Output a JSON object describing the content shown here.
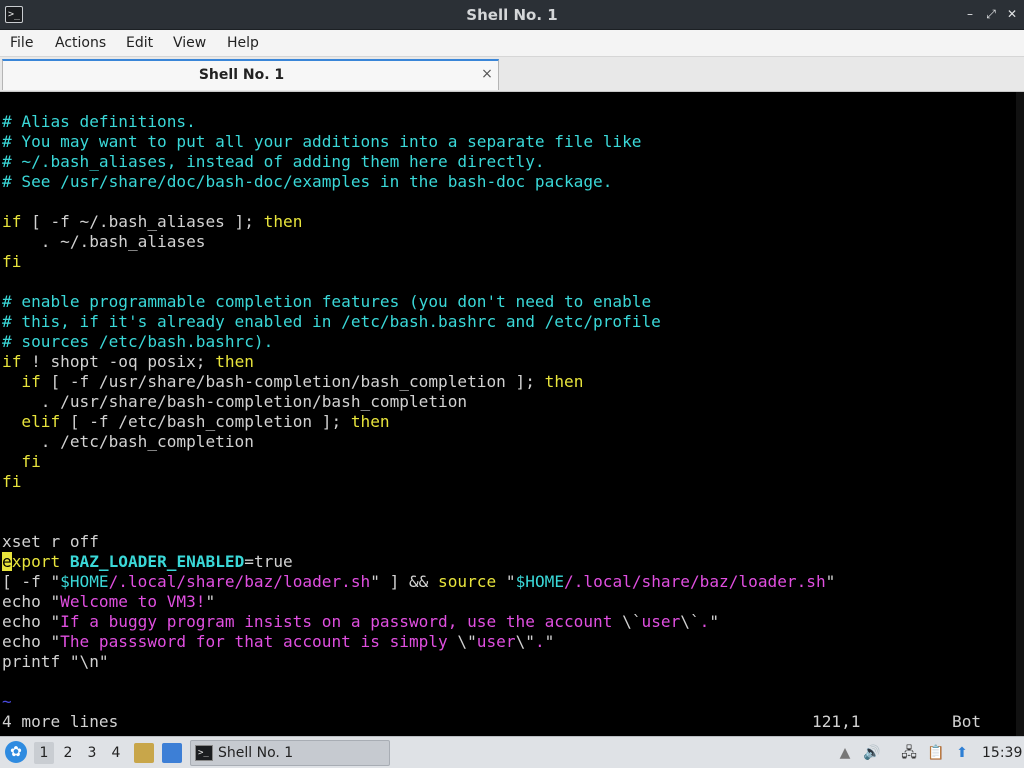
{
  "window": {
    "title": "Shell No. 1",
    "app_icon_glyph": ">_",
    "controls": {
      "minimize": "–",
      "maximize": "⤢",
      "close": "✕"
    }
  },
  "menubar": {
    "items": [
      {
        "label": "File"
      },
      {
        "label": "Actions"
      },
      {
        "label": "Edit"
      },
      {
        "label": "View"
      },
      {
        "label": "Help"
      }
    ]
  },
  "tabs": [
    {
      "label": "Shell No. 1",
      "close": "×",
      "active": true
    }
  ],
  "terminal": {
    "lines": [
      {
        "segments": [
          {
            "text": "# Alias definitions.",
            "cls": "c-cm"
          }
        ]
      },
      {
        "segments": [
          {
            "text": "# You may want to put all your additions into a separate file like",
            "cls": "c-cm"
          }
        ]
      },
      {
        "segments": [
          {
            "text": "# ~/.bash_aliases, instead of adding them here directly.",
            "cls": "c-cm"
          }
        ]
      },
      {
        "segments": [
          {
            "text": "# See /usr/share/doc/bash-doc/examples in the bash-doc package.",
            "cls": "c-cm"
          }
        ]
      },
      {
        "segments": []
      },
      {
        "segments": [
          {
            "text": "if",
            "cls": "c-kw"
          },
          {
            "text": " [ -f ~/.bash_aliases ]; "
          },
          {
            "text": "then",
            "cls": "c-kw"
          }
        ]
      },
      {
        "segments": [
          {
            "text": "    . ~/.bash_aliases"
          }
        ]
      },
      {
        "segments": [
          {
            "text": "fi",
            "cls": "c-kw"
          }
        ]
      },
      {
        "segments": []
      },
      {
        "segments": [
          {
            "text": "# enable programmable completion features (you don't need to enable",
            "cls": "c-cm"
          }
        ]
      },
      {
        "segments": [
          {
            "text": "# this, if it's already enabled in /etc/bash.bashrc and /etc/profile",
            "cls": "c-cm"
          }
        ]
      },
      {
        "segments": [
          {
            "text": "# sources /etc/bash.bashrc).",
            "cls": "c-cm"
          }
        ]
      },
      {
        "segments": [
          {
            "text": "if",
            "cls": "c-kw"
          },
          {
            "text": " ! shopt -oq posix; "
          },
          {
            "text": "then",
            "cls": "c-kw"
          }
        ]
      },
      {
        "segments": [
          {
            "text": "  "
          },
          {
            "text": "if",
            "cls": "c-kw"
          },
          {
            "text": " [ -f /usr/share/bash-completion/bash_completion ]; "
          },
          {
            "text": "then",
            "cls": "c-kw"
          }
        ]
      },
      {
        "segments": [
          {
            "text": "    . /usr/share/bash-completion/bash_completion"
          }
        ]
      },
      {
        "segments": [
          {
            "text": "  "
          },
          {
            "text": "elif",
            "cls": "c-kw"
          },
          {
            "text": " [ -f /etc/bash_completion ]; "
          },
          {
            "text": "then",
            "cls": "c-kw"
          }
        ]
      },
      {
        "segments": [
          {
            "text": "    . /etc/bash_completion"
          }
        ]
      },
      {
        "segments": [
          {
            "text": "  "
          },
          {
            "text": "fi",
            "cls": "c-kw"
          }
        ]
      },
      {
        "segments": [
          {
            "text": "fi",
            "cls": "c-kw"
          }
        ]
      },
      {
        "segments": []
      },
      {
        "segments": []
      },
      {
        "segments": [
          {
            "text": "xset r off"
          }
        ]
      },
      {
        "segments": [
          {
            "text": "e",
            "cls": "cursor"
          },
          {
            "text": "xport",
            "cls": "c-kw"
          },
          {
            "text": " "
          },
          {
            "text": "BAZ_LOADER_ENABLED",
            "cls": "c-bold"
          },
          {
            "text": "=true"
          }
        ]
      },
      {
        "segments": [
          {
            "text": "[ -f \""
          },
          {
            "text": "$HOME",
            "cls": "c-var"
          },
          {
            "text": "/.local/share/baz/loader.sh",
            "cls": "c-str"
          },
          {
            "text": "\" ] && "
          },
          {
            "text": "source",
            "cls": "c-kw"
          },
          {
            "text": " \""
          },
          {
            "text": "$HOME",
            "cls": "c-var"
          },
          {
            "text": "/.local/share/baz/loader.sh",
            "cls": "c-str"
          },
          {
            "text": "\""
          }
        ]
      },
      {
        "segments": [
          {
            "text": "echo \""
          },
          {
            "text": "Welcome to VM3!",
            "cls": "c-str"
          },
          {
            "text": "\""
          }
        ]
      },
      {
        "segments": [
          {
            "text": "echo \""
          },
          {
            "text": "If a buggy program insists on a password, use the account ",
            "cls": "c-str"
          },
          {
            "text": "\\`"
          },
          {
            "text": "user",
            "cls": "c-str"
          },
          {
            "text": "\\`"
          },
          {
            "text": ".",
            "cls": "c-str"
          },
          {
            "text": "\""
          }
        ]
      },
      {
        "segments": [
          {
            "text": "echo \""
          },
          {
            "text": "The passsword for that account is simply ",
            "cls": "c-str"
          },
          {
            "text": "\\\""
          },
          {
            "text": "user",
            "cls": "c-str"
          },
          {
            "text": "\\\""
          },
          {
            "text": ".",
            "cls": "c-str"
          },
          {
            "text": "\""
          }
        ]
      },
      {
        "segments": [
          {
            "text": "printf \"\\n\""
          }
        ]
      },
      {
        "segments": []
      },
      {
        "segments": [
          {
            "text": "~",
            "cls": "c-tilde"
          }
        ]
      }
    ],
    "status": {
      "message": "4 more lines",
      "position": "121,1",
      "scroll": "Bot"
    }
  },
  "taskbar": {
    "start_glyph": "✿",
    "workspaces": [
      {
        "label": "1",
        "active": true
      },
      {
        "label": "2",
        "active": false
      },
      {
        "label": "3",
        "active": false
      },
      {
        "label": "4",
        "active": false
      }
    ],
    "task": {
      "label": "Shell No. 1",
      "icon_glyph": ">_"
    },
    "tray": {
      "eject_glyph": "▲",
      "volume_glyph": "🔊",
      "network_glyph": "🖧",
      "clipboard_glyph": "📋",
      "update_glyph": "⬆"
    },
    "clock": "15:39"
  }
}
